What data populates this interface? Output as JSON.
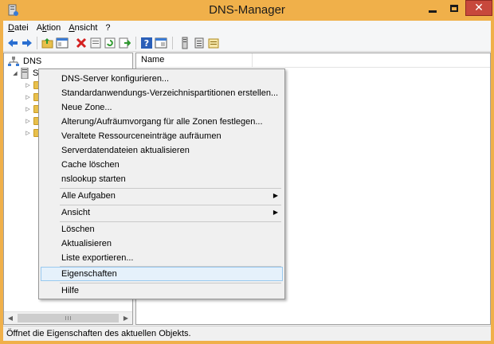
{
  "window": {
    "title": "DNS-Manager"
  },
  "menubar": {
    "items": [
      {
        "label": "Datei"
      },
      {
        "label": "Aktion"
      },
      {
        "label": "Ansicht"
      },
      {
        "label": "?"
      }
    ]
  },
  "toolbar": {
    "icons": [
      "back-icon",
      "forward-icon",
      "up-folder-icon",
      "show-hide-tree-icon",
      "delete-icon",
      "properties-icon",
      "refresh-icon",
      "export-icon",
      "help-icon",
      "console-icon",
      "server-icon",
      "list-icon",
      "folder-options-icon"
    ]
  },
  "tree": {
    "root_label": "DNS",
    "server_label": "S"
  },
  "list": {
    "column_name": "Name"
  },
  "context_menu": {
    "items": [
      {
        "label": "DNS-Server konfigurieren..."
      },
      {
        "label": "Standardanwendungs-Verzeichnispartitionen erstellen..."
      },
      {
        "label": "Neue Zone..."
      },
      {
        "label": "Alterung/Aufräumvorgang für alle Zonen festlegen..."
      },
      {
        "label": "Veraltete Ressourceneinträge aufräumen"
      },
      {
        "label": "Serverdatendateien aktualisieren"
      },
      {
        "label": "Cache löschen"
      },
      {
        "label": "nslookup starten"
      },
      {
        "label": "Alle Aufgaben"
      },
      {
        "label": "Ansicht"
      },
      {
        "label": "Löschen"
      },
      {
        "label": "Aktualisieren"
      },
      {
        "label": "Liste exportieren..."
      },
      {
        "label": "Eigenschaften"
      },
      {
        "label": "Hilfe"
      }
    ],
    "highlighted": "Eigenschaften"
  },
  "statusbar": {
    "text": "Öffnet die Eigenschaften des aktuellen Objekts."
  },
  "colors": {
    "titlebar": "#f0b04a",
    "close_button": "#c7483c",
    "highlight_bg": "#e5f1fb",
    "highlight_border": "#99c9ef"
  }
}
